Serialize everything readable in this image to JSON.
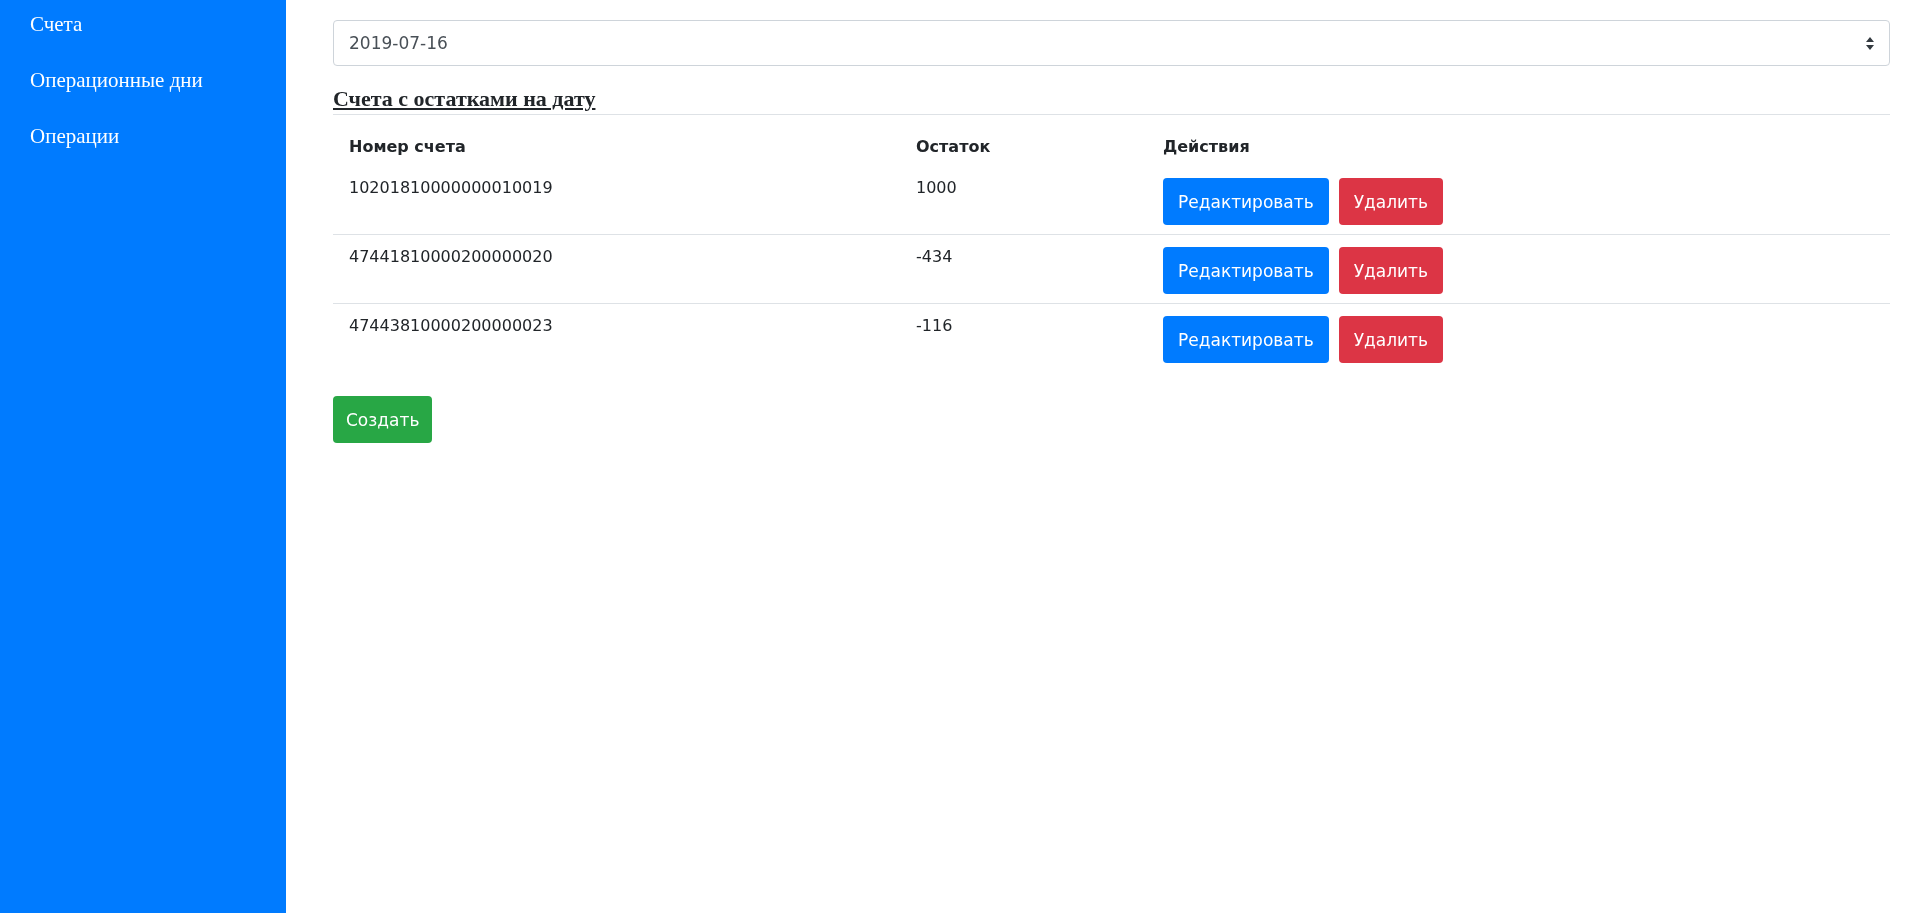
{
  "sidebar": {
    "items": [
      {
        "label": "Счета"
      },
      {
        "label": "Операционные дни"
      },
      {
        "label": "Операции"
      }
    ]
  },
  "date_select": {
    "value": "2019-07-16"
  },
  "section_title": "Счета с остатками на дату",
  "table": {
    "columns": [
      "Номер счета",
      "Остаток",
      "Действия"
    ],
    "rows": [
      {
        "account": "10201810000000010019",
        "balance": "1000",
        "actions": [
          "Редактировать",
          "Удалить"
        ]
      },
      {
        "account": "47441810000200000020",
        "balance": "-434",
        "actions": [
          "Редактировать",
          "Удалить"
        ]
      },
      {
        "account": "47443810000200000023",
        "balance": "-116",
        "actions": [
          "Редактировать",
          "Удалить"
        ]
      }
    ]
  },
  "create_button": "Создать"
}
